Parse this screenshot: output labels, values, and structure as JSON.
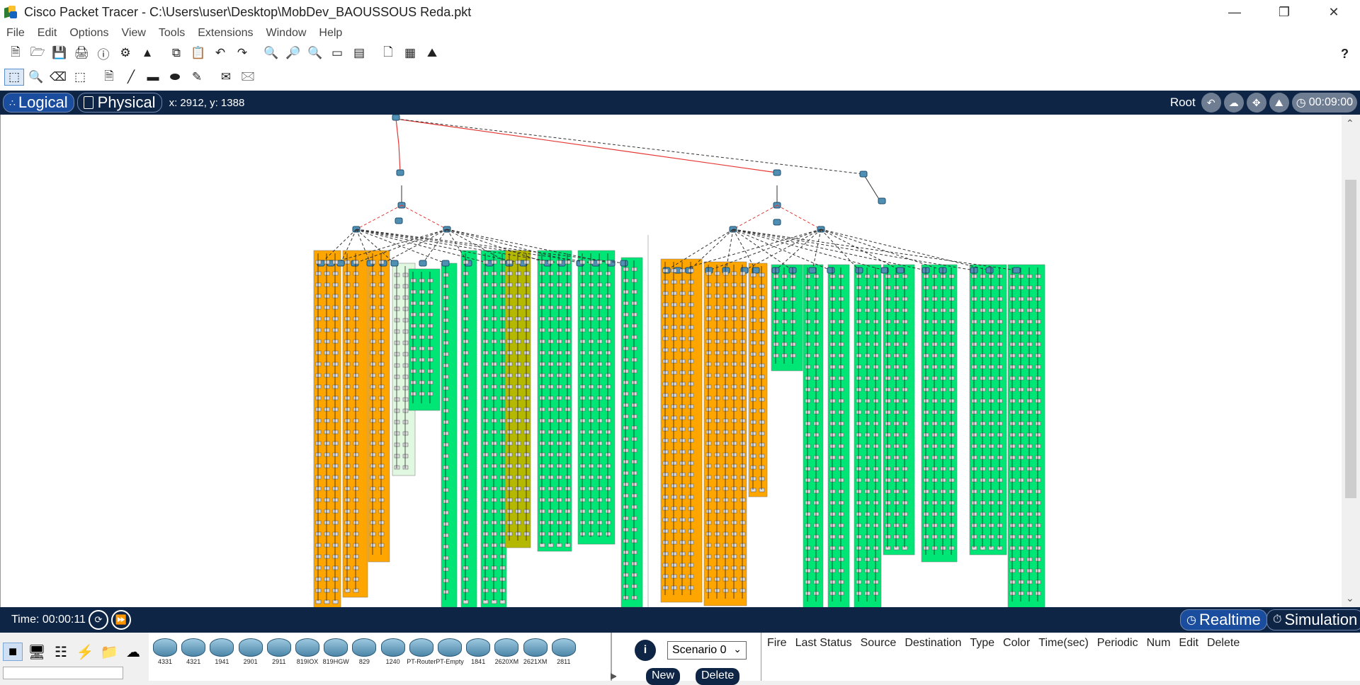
{
  "window": {
    "title": "Cisco Packet Tracer - C:\\Users\\user\\Desktop\\MobDev_BAOUSSOUS Reda.pkt"
  },
  "menu": [
    "File",
    "Edit",
    "Options",
    "View",
    "Tools",
    "Extensions",
    "Window",
    "Help"
  ],
  "toolbar": {
    "icons1": [
      "new-file-icon",
      "open-folder-icon",
      "save-icon",
      "print-icon",
      "info-icon",
      "network-wizard-icon",
      "activity-wizard-icon",
      "copy-icon",
      "paste-icon",
      "undo-icon",
      "redo-icon",
      "zoom-in-icon",
      "zoom-reset-icon",
      "zoom-out-icon",
      "rectangle-select-icon",
      "list-icon",
      "custom-device-icon",
      "cluster-icon",
      "image-icon"
    ],
    "icons2": [
      "select-icon",
      "inspect-icon",
      "delete-icon",
      "resize-icon",
      "note-icon",
      "line-icon",
      "rectangle-icon",
      "ellipse-icon",
      "freeform-icon",
      "simple-pdu-icon",
      "complex-pdu-icon"
    ],
    "help": "?"
  },
  "navbar": {
    "logical_label": "Logical",
    "physical_label": "Physical",
    "coords": "x: 2912, y: 1388",
    "root_label": "Root",
    "clock": "00:09:00"
  },
  "statusbar": {
    "time": "Time: 00:00:11",
    "realtime": "Realtime",
    "simulation": "Simulation"
  },
  "devices": [
    "4331",
    "4321",
    "1941",
    "2901",
    "2911",
    "819IOX",
    "819HGW",
    "829",
    "1240",
    "PT-Router",
    "PT-Empty",
    "1841",
    "2620XM",
    "2621XM",
    "2811"
  ],
  "scenario": {
    "info": "i",
    "selected": "Scenario 0",
    "new_label": "New",
    "delete_label": "Delete"
  },
  "pdu_columns": [
    "Fire",
    "Last Status",
    "Source",
    "Destination",
    "Type",
    "Color",
    "Time(sec)",
    "Periodic",
    "Num",
    "Edit",
    "Delete"
  ],
  "colors": {
    "nav_bg": "#0f2546",
    "zone_orange": "#ffa500",
    "zone_green": "#00e676",
    "zone_olive": "#b5b800",
    "link_red": "#e53935"
  }
}
